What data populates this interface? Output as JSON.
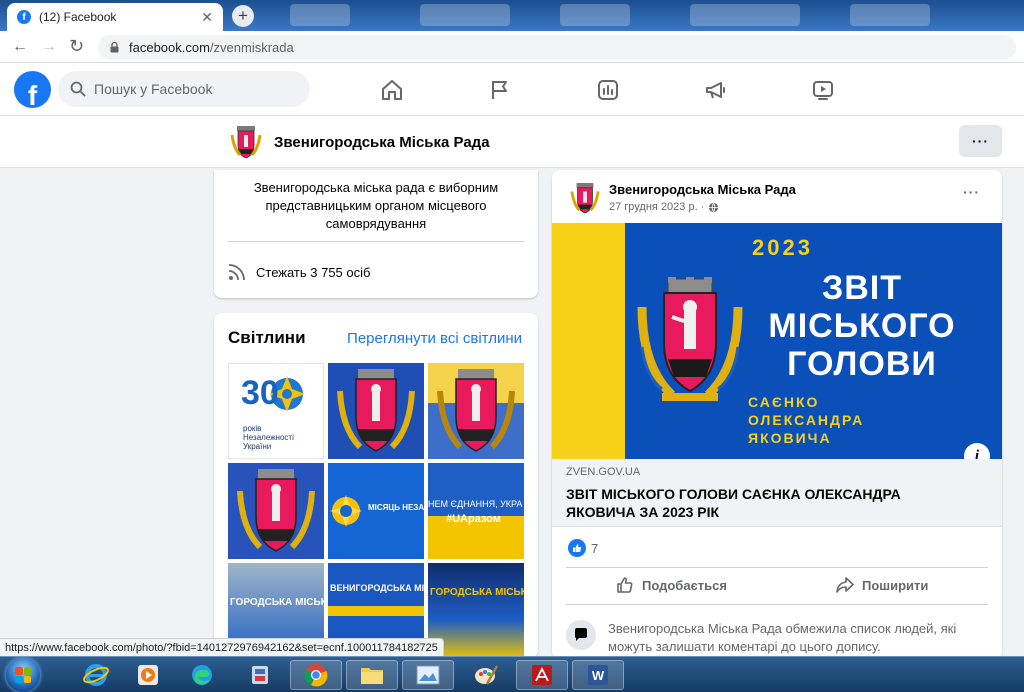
{
  "browser": {
    "tab_title": "(12) Facebook",
    "tab_close": "✕",
    "new_tab": "+",
    "url_host": "facebook.com",
    "url_path": "/zvenmiskrada",
    "back": "←",
    "forward": "→",
    "reload": "↻",
    "status_url": "https://www.facebook.com/photo/?fbid=1401272976942162&set=ecnf.100011784182725"
  },
  "fb": {
    "logo": "f",
    "search_placeholder": "Пошук у Facebook"
  },
  "page": {
    "name": "Звенигородська Міська Рада",
    "more": "···"
  },
  "about": {
    "description": "Звенигородська міська рада є виборним представницьким органом місцевого самоврядування",
    "followers": "Стежать 3 755 осіб"
  },
  "photos": {
    "title": "Світлини",
    "see_all": "Переглянути всі світлини",
    "items": [
      {
        "caption_num": "30",
        "caption": "років Незалежності України"
      },
      {
        "caption": ""
      },
      {
        "caption": ""
      },
      {
        "caption": ""
      },
      {
        "caption": "МІСЯЦЬ НЕЗАЛЕЖНОСТІ"
      },
      {
        "caption": "НЕМ ЄДНАННЯ, УКРА",
        "caption2": "#UAразом"
      },
      {
        "caption": "ГОРОДСЬКА МІСЬКА"
      },
      {
        "caption": "ВЕНИГОРОДСЬКА МІСЬКА"
      },
      {
        "caption": "ГОРОДСЬКА МІСЬКА"
      }
    ]
  },
  "post": {
    "author": "Звенигородська Міська Рада",
    "date": "27 грудня 2023 р. ·",
    "menu": "···",
    "banner": {
      "year": "2023",
      "title_lines": "ЗВІТ МІСЬКОГО ГОЛОВИ",
      "name_lines": "САЄНКО ОЛЕКСАНДРА ЯКОВИЧА",
      "info": "i"
    },
    "link": {
      "domain": "ZVEN.GOV.UA",
      "title": "ЗВІТ МІСЬКОГО ГОЛОВИ САЄНКА ОЛЕКСАНДРА ЯКОВИЧА ЗА 2023 РІК"
    },
    "like_count": "7",
    "like_label": "Подобається",
    "share_label": "Поширити",
    "restriction": "Звенигородська Міська Рада обмежила список людей, які можуть залишати коментарі до цього допису."
  },
  "colors": {
    "fb_blue": "#1877f2",
    "banner_blue": "#0b4fb8",
    "banner_yellow": "#f7d118",
    "crest_pink": "#e8195c"
  },
  "taskbar": {
    "icons": [
      "internet-explorer",
      "media-player",
      "edge",
      "app-icon",
      "chrome",
      "file-explorer",
      "image-viewer",
      "paint",
      "acrobat",
      "word"
    ]
  }
}
